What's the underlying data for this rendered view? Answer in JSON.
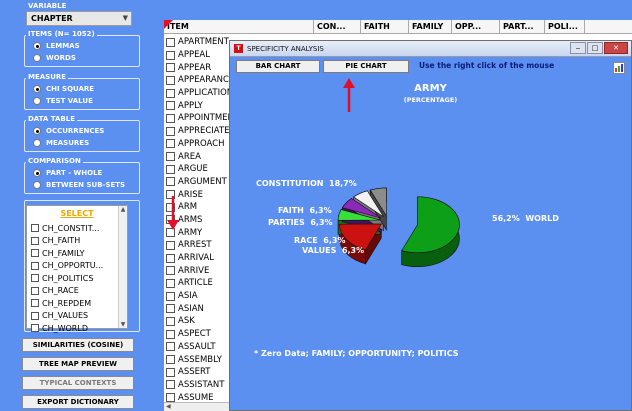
{
  "left_panel": {
    "variable": {
      "title": "VARIABLE",
      "selected": "CHAPTER"
    },
    "items": {
      "title": "ITEMS (N= 1052)",
      "options": [
        "LEMMAS",
        "WORDS"
      ],
      "selected_index": 0
    },
    "measure": {
      "title": "MEASURE",
      "options": [
        "CHI SQUARE",
        "TEST VALUE"
      ],
      "selected_index": 0
    },
    "data_table": {
      "title": "DATA TABLE",
      "options": [
        "OCCURRENCES",
        "MEASURES"
      ],
      "selected_index": 0
    },
    "comparison": {
      "title": "COMPARISON",
      "options": [
        "PART - WHOLE",
        "BETWEEN SUB-SETS"
      ],
      "selected_index": 0
    },
    "select_link": "SELECT",
    "subsets": [
      "CH_CONSTIT...",
      "CH_FAITH",
      "CH_FAMILY",
      "CH_OPPORTU...",
      "CH_POLITICS",
      "CH_RACE",
      "CH_REPDEM",
      "CH_VALUES",
      "CH_WORLD"
    ],
    "buttons": {
      "similarities": "SIMILARITIES (COSINE)",
      "tree_map": "TREE MAP PREVIEW",
      "typical_contexts": "TYPICAL CONTEXTS",
      "export_dictionary": "EXPORT DICTIONARY"
    }
  },
  "table": {
    "headers": [
      "ITEM",
      "CON...",
      "FAITH",
      "FAMILY",
      "OPP...",
      "PART...",
      "POLI..."
    ],
    "rows": [
      "APARTMENT",
      "APPEAL",
      "APPEAR",
      "APPEARANCE",
      "APPLICATION",
      "APPLY",
      "APPOINTMENT",
      "APPRECIATE",
      "APPROACH",
      "AREA",
      "ARGUE",
      "ARGUMENT",
      "ARISE",
      "ARM",
      "ARMS",
      "ARMY",
      "ARREST",
      "ARRIVAL",
      "ARRIVE",
      "ARTICLE",
      "ASIA",
      "ASIAN",
      "ASK",
      "ASPECT",
      "ASSAULT",
      "ASSEMBLY",
      "ASSERT",
      "ASSISTANT",
      "ASSUME"
    ]
  },
  "window": {
    "title": "SPECIFICITY ANALYSIS",
    "bar_chart_button": "BAR CHART",
    "pie_chart_button": "PIE CHART",
    "hint": "Use the right click of the mouse"
  },
  "chart_data": {
    "type": "pie",
    "title": "ARMY",
    "subtitle": "(PERCENTAGE)",
    "slices": [
      {
        "label": "WORLD",
        "value": 56.2,
        "display": "56,2%",
        "color": "#0e9f18"
      },
      {
        "label": "CONSTITUTION",
        "value": 18.7,
        "display": "18,7%",
        "color": "#cc1111"
      },
      {
        "label": "FAITH",
        "value": 6.3,
        "display": "6,3%",
        "color": "#36e03a"
      },
      {
        "label": "PARTIES",
        "value": 6.3,
        "display": "6,3%",
        "color": "#8a2ab8"
      },
      {
        "label": "RACE",
        "value": 6.3,
        "display": "6,3%",
        "color": "#f2f2f2"
      },
      {
        "label": "VALUES",
        "value": 6.3,
        "display": "6,3%",
        "color": "#8c8c8c"
      }
    ],
    "note": "* Zero Data; FAMILY; OPPORTUNITY; POLITICS"
  },
  "colors": {
    "background": "#5b8ff0",
    "annotation_arrow": "#e0102a",
    "hint_text": "#0c1c7a"
  }
}
